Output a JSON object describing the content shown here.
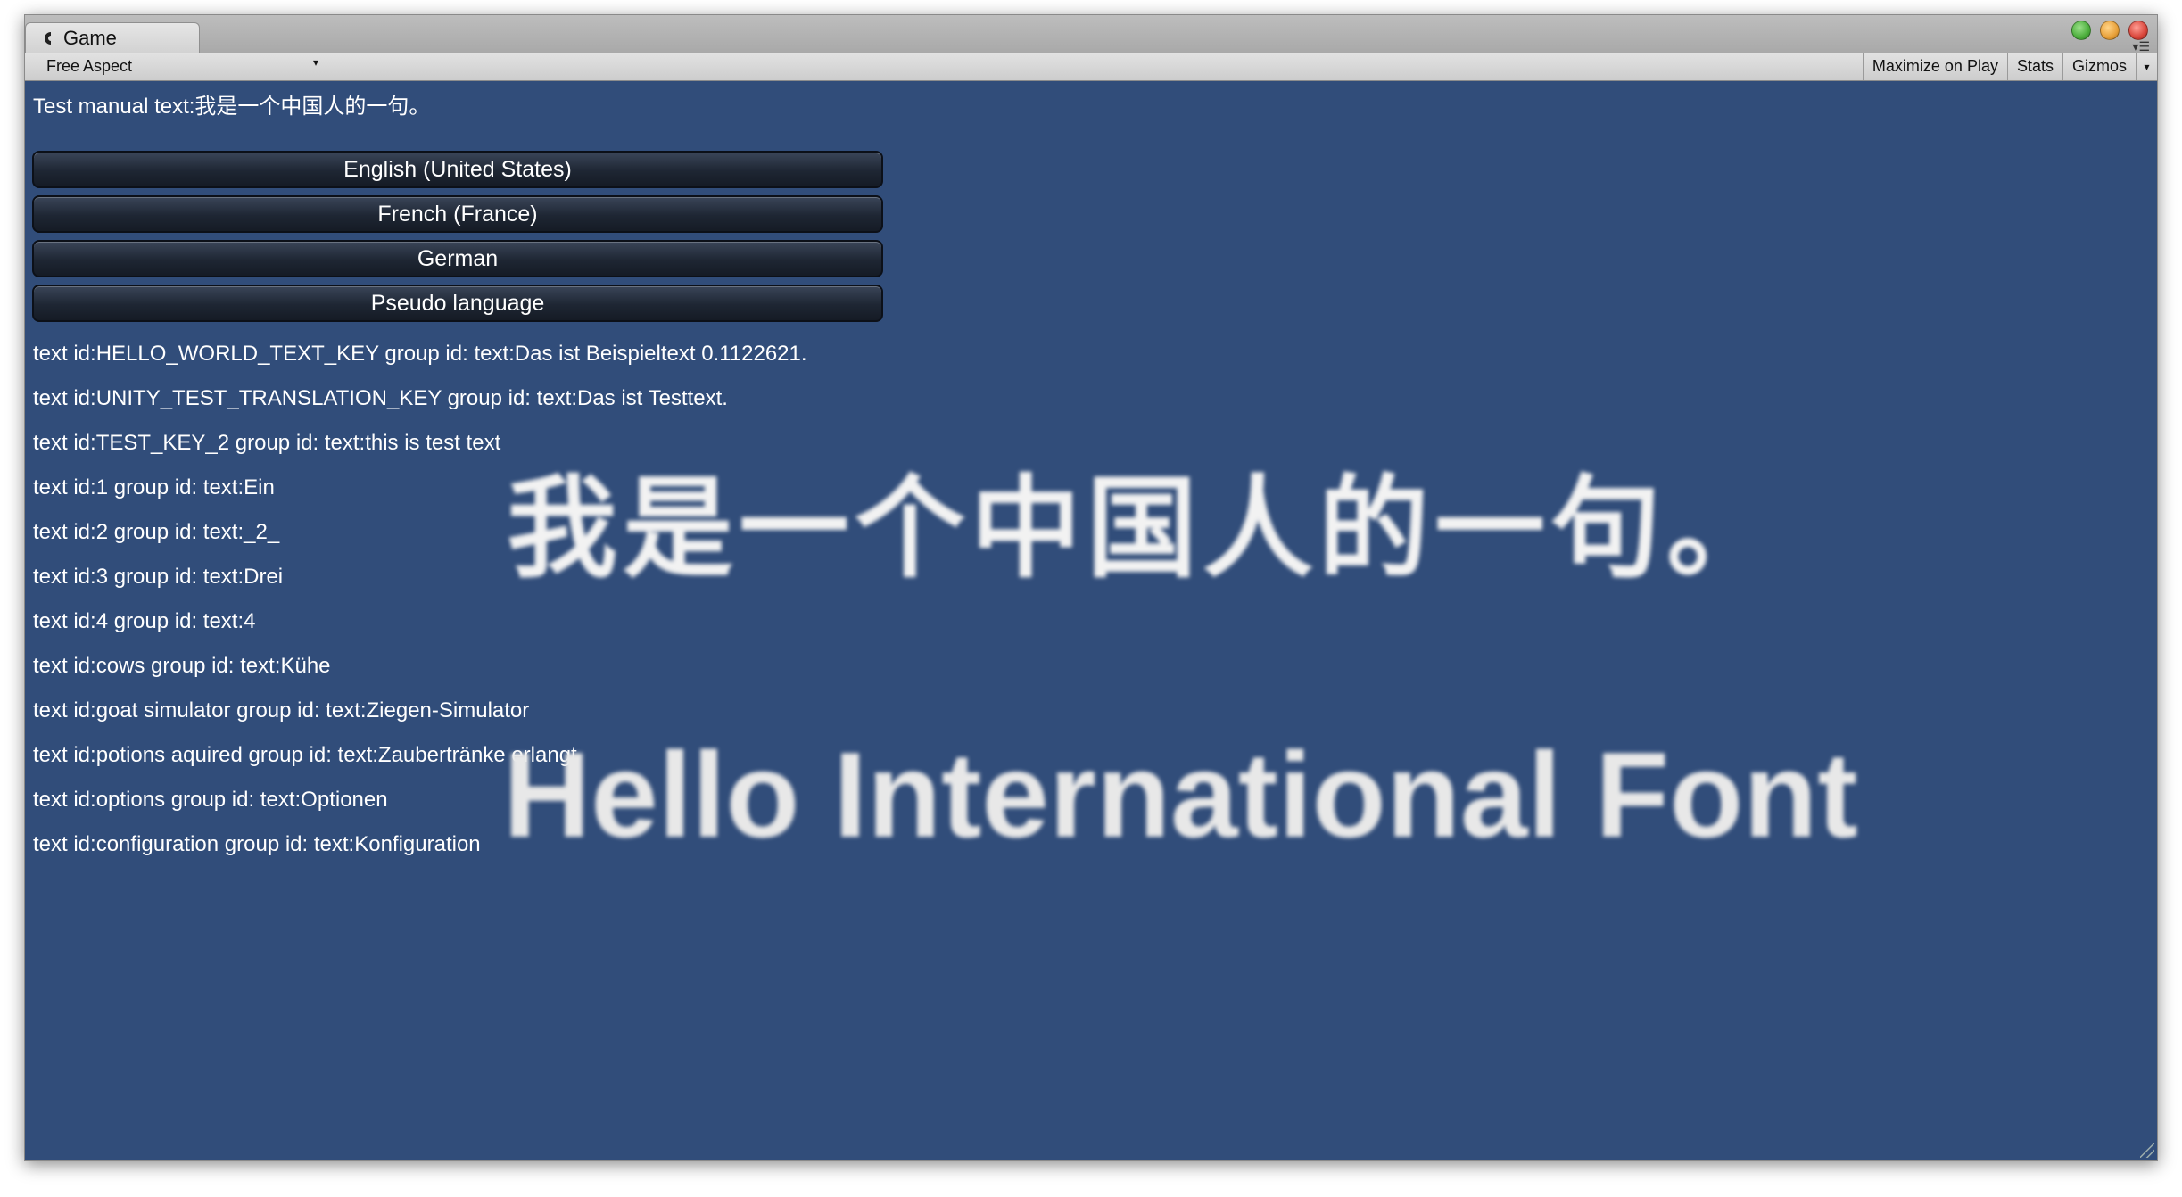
{
  "tab": {
    "title": "Game",
    "icon": "game-controller-icon"
  },
  "window_controls": {
    "colors": [
      "#4cae3c",
      "#e8a13a",
      "#d9453a"
    ]
  },
  "toolbar": {
    "aspect_label": "Free Aspect",
    "maximize_label": "Maximize on Play",
    "stats_label": "Stats",
    "gizmos_label": "Gizmos"
  },
  "game": {
    "background_color": "#314d7a",
    "manual_text": "Test manual text:我是一个中国人的一句。",
    "language_buttons": [
      "English (United States)",
      "French (France)",
      "German",
      "Pseudo language"
    ],
    "entries": [
      "text id:HELLO_WORLD_TEXT_KEY group id: text:Das ist Beispieltext 0.1122621.",
      "text id:UNITY_TEST_TRANSLATION_KEY group id: text:Das ist Testtext.",
      "text id:TEST_KEY_2 group id: text:this is test text",
      "text id:1 group id: text:Ein",
      "text id:2 group id: text:_2_",
      "text id:3 group id: text:Drei",
      "text id:4 group id: text:4",
      "text id:cows group id: text:Kühe",
      "text id:goat simulator group id: text:Ziegen-Simulator",
      "text id:potions aquired group id: text:Zaubertränke erlangt",
      "text id:options group id: text:Optionen",
      "text id:configuration group id: text:Konfiguration"
    ],
    "big_chinese_text": "我是一个中国人的一句。",
    "big_english_text": "Hello International Font"
  }
}
